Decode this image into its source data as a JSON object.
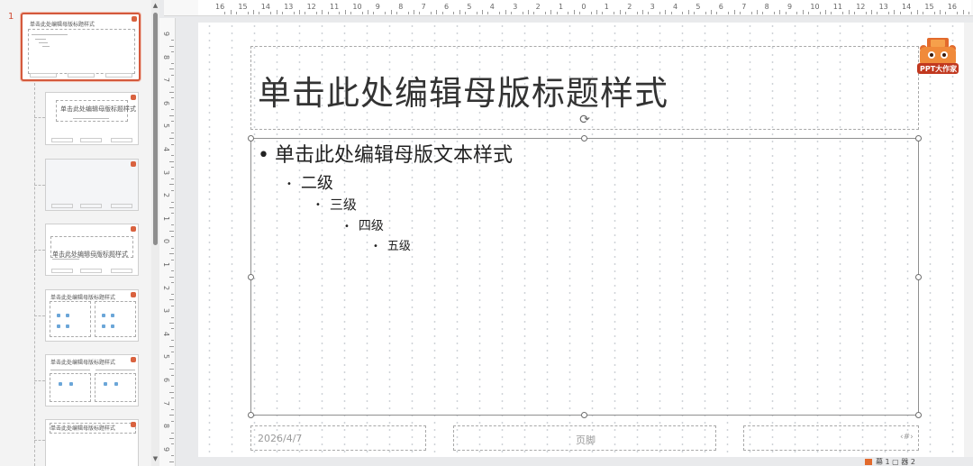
{
  "thumbnails": {
    "first_index": "1",
    "slide1_title": "单击此处编辑母版标题样式",
    "slide2_title": "单击此处编辑母版标题样式",
    "slide4_title": "单击此处编辑母版标题样式",
    "slide5_title": "单击此处编辑母版标题样式",
    "slide6_title": "单击此处编辑母版标题样式",
    "slide7_title": "单击此处编辑母版标题样式"
  },
  "ruler_top": [
    "16",
    "15",
    "14",
    "13",
    "12",
    "11",
    "10",
    "9",
    "8",
    "7",
    "6",
    "5",
    "4",
    "3",
    "2",
    "1",
    "0",
    "1",
    "2",
    "3",
    "4",
    "5",
    "6",
    "7",
    "8",
    "9",
    "10",
    "11",
    "12",
    "13",
    "14",
    "15",
    "16"
  ],
  "ruler_left": [
    "9",
    "8",
    "7",
    "6",
    "5",
    "4",
    "3",
    "2",
    "1",
    "0",
    "1",
    "2",
    "3",
    "4",
    "5",
    "6",
    "7",
    "8",
    "9"
  ],
  "slide": {
    "title": "单击此处编辑母版标题样式",
    "level1": "单击此处编辑母版文本样式",
    "level2": "二级",
    "level3": "三级",
    "level4": "四级",
    "level5": "五级",
    "bullet": "•",
    "date": "2026/4/7",
    "footer": "页脚",
    "page_number": "‹#›",
    "logo_text": "PPT大作家"
  },
  "status": {
    "partial": "幕 1 ▢ 器 2"
  },
  "colors": {
    "accent": "#d4593c",
    "thumb_panel": "#f3f3f3",
    "canvas": "#e9eaec"
  }
}
